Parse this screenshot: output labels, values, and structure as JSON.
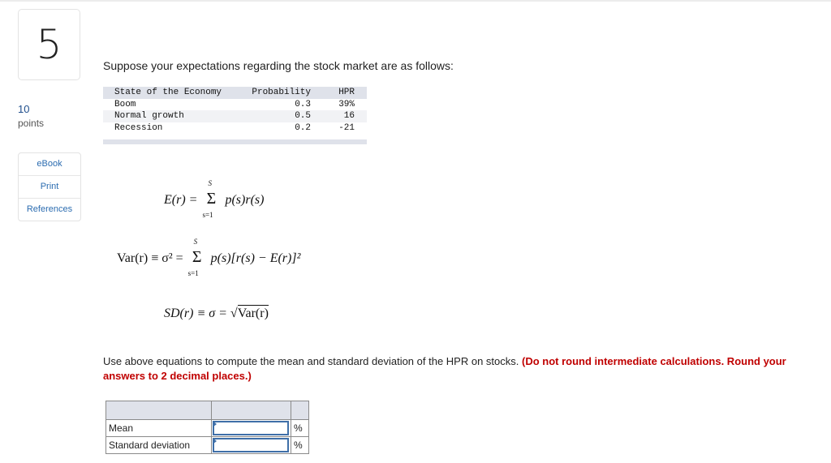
{
  "question": {
    "number": "5",
    "points_value": "10",
    "points_label": "points",
    "resources": [
      {
        "label": "eBook"
      },
      {
        "label": "Print"
      },
      {
        "label": "References"
      }
    ],
    "intro": "Suppose your expectations regarding the stock market are as follows:",
    "economy_table": {
      "headers": [
        "State of the Economy",
        "Probability",
        "HPR"
      ],
      "rows": [
        {
          "state": "Boom",
          "probability": "0.3",
          "hpr": "39%"
        },
        {
          "state": "Normal growth",
          "probability": "0.5",
          "hpr": "16"
        },
        {
          "state": "Recession",
          "probability": "0.2",
          "hpr": "-21"
        }
      ]
    },
    "equations": {
      "expected_return": {
        "lhs": "E(r) =",
        "sum_upper": "S",
        "sum_lower": "s=1",
        "rhs": "p(s)r(s)"
      },
      "variance": {
        "lhs": "Var(r) ≡ σ² =",
        "sum_upper": "S",
        "sum_lower": "s=1",
        "rhs": "p(s)[r(s) − E(r)]²"
      },
      "std_dev": {
        "lhs": "SD(r) ≡ σ = √",
        "rhs": "Var(r)"
      }
    },
    "instructions": "Use above equations to compute the mean and standard deviation of the HPR on stocks.",
    "warning": "(Do not round intermediate calculations. Round your answers to 2 decimal places.)",
    "answer_table": {
      "rows": [
        {
          "label": "Mean",
          "value": "",
          "unit": "%"
        },
        {
          "label": "Standard deviation",
          "value": "",
          "unit": "%"
        }
      ]
    }
  }
}
